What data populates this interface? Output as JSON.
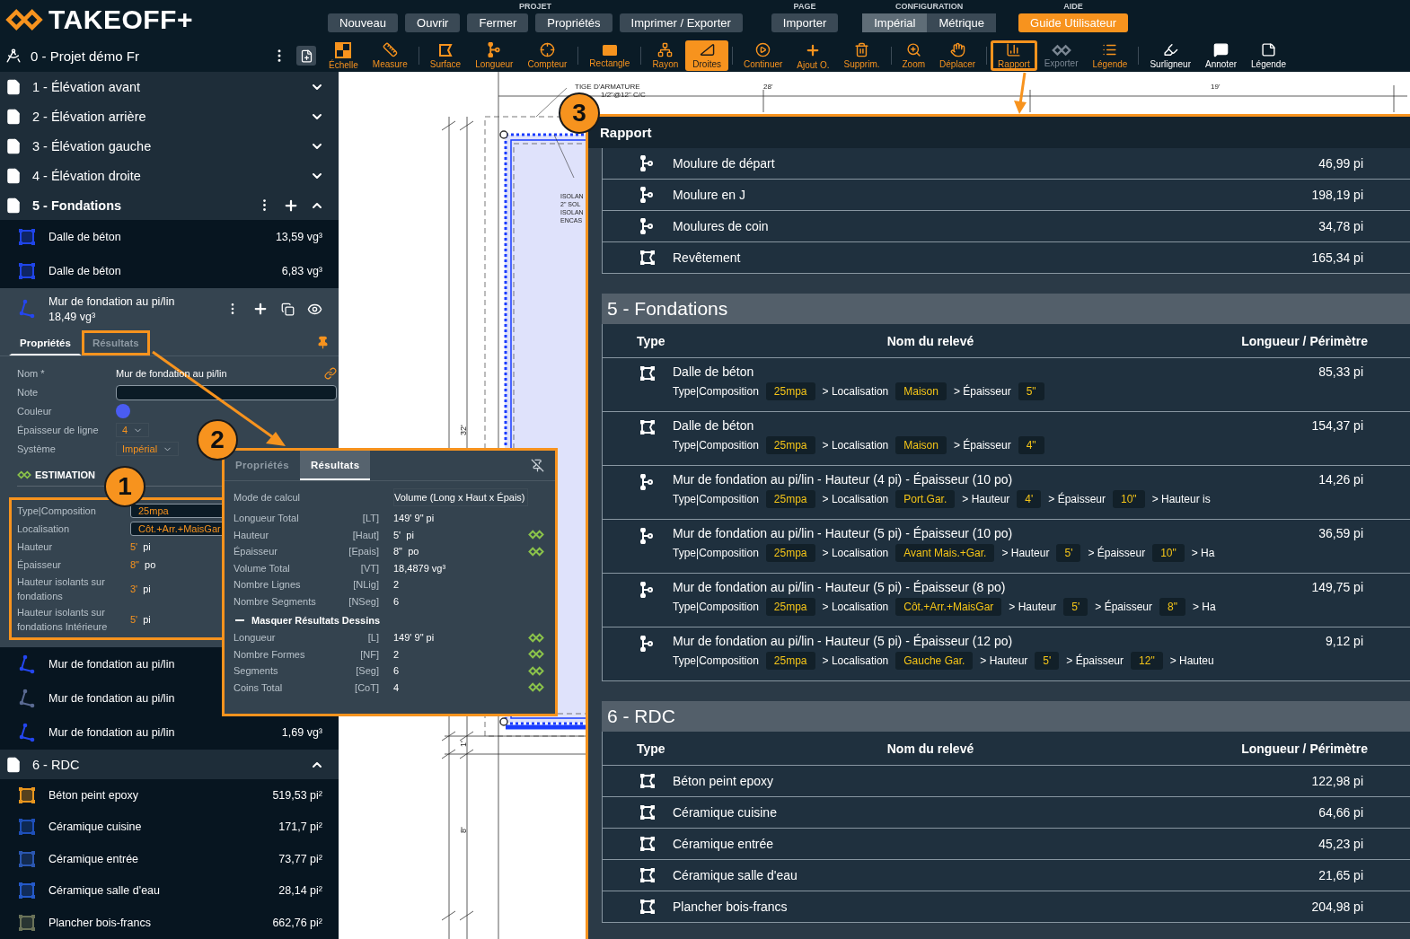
{
  "header": {
    "logo": "TAKEOFF+",
    "menu_groups": [
      {
        "title": "PROJET",
        "kind": "buttons",
        "buttons": [
          {
            "label": "Nouveau"
          },
          {
            "label": "Ouvrir"
          },
          {
            "label": "Fermer"
          },
          {
            "label": "Propriétés"
          },
          {
            "label": "Imprimer / Exporter"
          }
        ]
      },
      {
        "title": "PAGE",
        "kind": "buttons",
        "buttons": [
          {
            "label": "Importer"
          }
        ]
      },
      {
        "title": "CONFIGURATION",
        "kind": "segmented",
        "buttons": [
          {
            "label": "Impérial",
            "selected": true
          },
          {
            "label": "Métrique",
            "selected": false
          }
        ]
      },
      {
        "title": "AIDE",
        "kind": "primary",
        "buttons": [
          {
            "label": "Guide Utilisateur"
          }
        ]
      }
    ],
    "project": {
      "title": "0 - Projet démo Fr"
    },
    "toolbar": [
      {
        "tools": [
          {
            "label": "Échelle",
            "kind": "tool",
            "selected": false,
            "disabled": false,
            "highlighted": false
          },
          {
            "label": "Measure",
            "kind": "tool",
            "selected": false,
            "disabled": false,
            "highlighted": false
          }
        ]
      },
      {
        "tools": [
          {
            "label": "Surface",
            "kind": "tool",
            "selected": false,
            "disabled": false,
            "highlighted": false
          },
          {
            "label": "Longueur",
            "kind": "tool",
            "selected": false,
            "disabled": false,
            "highlighted": false
          },
          {
            "label": "Compteur",
            "kind": "tool",
            "selected": false,
            "disabled": false,
            "highlighted": false
          }
        ]
      },
      {
        "tools": [
          {
            "label": "Rectangle",
            "kind": "tool",
            "selected": false,
            "disabled": false,
            "highlighted": false
          }
        ]
      },
      {
        "tools": [
          {
            "label": "Rayon",
            "kind": "tool",
            "selected": false,
            "disabled": false,
            "highlighted": false
          },
          {
            "label": "Droites",
            "kind": "tool",
            "selected": true,
            "disabled": false,
            "highlighted": false
          }
        ]
      },
      {
        "tools": [
          {
            "label": "Continuer",
            "kind": "tool",
            "selected": false,
            "disabled": false,
            "highlighted": false
          },
          {
            "label": "Ajout O.",
            "kind": "tool",
            "selected": false,
            "disabled": false,
            "highlighted": false
          },
          {
            "label": "Supprim.",
            "kind": "tool",
            "selected": false,
            "disabled": false,
            "highlighted": false
          }
        ]
      },
      {
        "tools": [
          {
            "label": "Zoom",
            "kind": "tool",
            "selected": false,
            "disabled": false,
            "highlighted": false
          },
          {
            "label": "Déplacer",
            "kind": "tool",
            "selected": false,
            "disabled": false,
            "highlighted": false
          }
        ]
      },
      {
        "tools": [
          {
            "label": "Rapport",
            "kind": "tool",
            "selected": false,
            "disabled": false,
            "highlighted": true
          },
          {
            "label": "Exporter",
            "kind": "tool",
            "selected": false,
            "disabled": true,
            "highlighted": false
          },
          {
            "label": "Légende",
            "kind": "tool",
            "selected": false,
            "disabled": false,
            "highlighted": false
          }
        ]
      },
      {
        "tools": [
          {
            "label": "Surligneur",
            "kind": "annotate",
            "selected": false,
            "disabled": false,
            "highlighted": false
          },
          {
            "label": "Annoter",
            "kind": "annotate",
            "selected": false,
            "disabled": false,
            "highlighted": false
          },
          {
            "label": "Légende",
            "kind": "annotate",
            "selected": false,
            "disabled": false,
            "highlighted": false
          }
        ]
      }
    ]
  },
  "sidebar": {
    "pages": [
      {
        "title": "1 - Élévation avant",
        "active": false,
        "expanded": false
      },
      {
        "title": "2 - Élévation arrière",
        "active": false,
        "expanded": false
      },
      {
        "title": "3 - Élévation gauche",
        "active": false,
        "expanded": false
      },
      {
        "title": "4 - Élévation droite",
        "active": false,
        "expanded": false
      },
      {
        "title": "5 - Fondations",
        "active": true,
        "expanded": true,
        "items": [
          {
            "name": "Dalle de béton",
            "value": "13,59 vg³",
            "kind": "area",
            "color": "#1f44e8",
            "selected": false
          },
          {
            "name": "Dalle de béton",
            "value": "6,83 vg³",
            "kind": "area",
            "color": "#1f44e8",
            "selected": false
          },
          {
            "name": "Mur de fondation au pi/lin",
            "value": "18,49 vg³",
            "kind": "line",
            "color": "#2446f0",
            "selected": true
          },
          {
            "name": "Mur de fondation au pi/lin",
            "kind": "line",
            "color": "#2446f0",
            "selected": false
          },
          {
            "name": "Mur de fondation au pi/lin",
            "kind": "line",
            "color": "#5a6a92",
            "selected": false
          },
          {
            "name": "Mur de fondation au pi/lin",
            "value": "1,69 vg³",
            "kind": "line",
            "color": "#2446f0",
            "selected": false
          }
        ]
      },
      {
        "title": "6 - RDC",
        "active": false,
        "expanded": true,
        "items": [
          {
            "name": "Béton peint epoxy",
            "value": "519,53 pi²",
            "kind": "area",
            "color": "#e8961e",
            "selected": false
          },
          {
            "name": "Céramique cuisine",
            "value": "171,7 pi²",
            "kind": "area",
            "color": "#1e4fb8",
            "selected": false
          },
          {
            "name": "Céramique entrée",
            "value": "73,77 pi²",
            "kind": "area",
            "color": "#2a56b0",
            "selected": false
          },
          {
            "name": "Céramique salle d'eau",
            "value": "28,14 pi²",
            "kind": "area",
            "color": "#2459c8",
            "selected": false
          },
          {
            "name": "Plancher bois-francs",
            "value": "662,76 pi²",
            "kind": "area",
            "color": "#6a7258",
            "selected": false
          }
        ]
      }
    ],
    "details": {
      "tabs": [
        {
          "label": "Propriétés",
          "selected": true,
          "highlighted": false
        },
        {
          "label": "Résultats",
          "selected": false,
          "highlighted": true
        }
      ],
      "fields": [
        {
          "label": "Nom *",
          "kind": "text",
          "value": "Mur de fondation au pi/lin"
        },
        {
          "label": "Note",
          "kind": "input"
        },
        {
          "label": "Couleur",
          "kind": "color",
          "color": "#4a5cf2"
        },
        {
          "label": "Épaisseur de ligne",
          "kind": "select",
          "value": "4"
        },
        {
          "label": "Système",
          "kind": "select",
          "value": "Impérial"
        }
      ],
      "estimation": {
        "title": "ESTIMATION",
        "rows": [
          {
            "label": "Type|Composition",
            "kind": "field",
            "value": "25mpa"
          },
          {
            "label": "Localisation",
            "kind": "field",
            "value": "Côt.+Arr.+MaisGar"
          },
          {
            "label": "Hauteur",
            "kind": "measure",
            "value": "5'",
            "unit": "pi"
          },
          {
            "label": "Épaisseur",
            "kind": "measure",
            "value": "8\"",
            "unit": "po"
          },
          {
            "label": "Hauteur isolants sur fondations",
            "kind": "measure",
            "value": "3'",
            "unit": "pi"
          },
          {
            "label": "Hauteur isolants sur fondations Intérieure",
            "kind": "measure",
            "value": "5'",
            "unit": "pi"
          }
        ]
      }
    }
  },
  "canvas": {
    "labels": [
      {
        "text": "TIGE D'ARMATURE"
      },
      {
        "text": "1/2\"@12\" C/C"
      },
      {
        "text": "28'"
      },
      {
        "text": "19'"
      },
      {
        "text": "ISOLAN"
      },
      {
        "text": "2\" SOL"
      },
      {
        "text": "ISOLAN"
      },
      {
        "text": "ENCAS"
      },
      {
        "text": "32'"
      },
      {
        "text": "1'"
      },
      {
        "text": "8'"
      }
    ]
  },
  "results_popup": {
    "tabs": [
      {
        "label": "Propriétés",
        "selected": false
      },
      {
        "label": "Résultats",
        "selected": true
      }
    ],
    "mode": {
      "label": "Mode de calcul",
      "value": "Volume (Long x Haut x Épais)"
    },
    "rows": [
      {
        "label": "Longueur Total",
        "code": "[LT]",
        "value": "149' 9\" pi",
        "linked": false
      },
      {
        "label": "Hauteur",
        "code": "[Haut]",
        "value": "5'  pi",
        "linked": true
      },
      {
        "label": "Épaisseur",
        "code": "[Epais]",
        "value": "8\"  po",
        "linked": true
      },
      {
        "label": "Volume Total",
        "code": "[VT]",
        "value": "18,4879 vg³",
        "linked": false
      },
      {
        "label": "Nombre Lignes",
        "code": "[NLig]",
        "value": "2",
        "linked": false
      },
      {
        "label": "Nombre Segments",
        "code": "[NSeg]",
        "value": "6",
        "linked": false
      }
    ],
    "section": {
      "title": "Masquer Résultats Dessins",
      "expanded": true
    },
    "section_rows": [
      {
        "label": "Longueur",
        "code": "[L]",
        "value": "149' 9\" pi",
        "linked": true
      },
      {
        "label": "Nombre Formes",
        "code": "[NF]",
        "value": "2",
        "linked": true
      },
      {
        "label": "Segments",
        "code": "[Seg]",
        "value": "6",
        "linked": true
      },
      {
        "label": "Coins Total",
        "code": "[CoT]",
        "value": "4",
        "linked": true
      }
    ]
  },
  "report": {
    "title": "Rapport",
    "summary": [
      {
        "name": "Moulure de départ",
        "value": "46,99 pi",
        "kind": "line"
      },
      {
        "name": "Moulure en J",
        "value": "198,19 pi",
        "kind": "line"
      },
      {
        "name": "Moulures de coin",
        "value": "34,78 pi",
        "kind": "line"
      },
      {
        "name": "Revêtement",
        "value": "165,34 pi",
        "kind": "area"
      }
    ],
    "sections": [
      {
        "title": "5 - Fondations",
        "columns": [
          "Type",
          "Nom du relevé",
          "Longueur / Périmètre"
        ],
        "rows": [
          {
            "kind": "area",
            "name": "Dalle de béton",
            "value": "85,33 pi",
            "attributes": [
              {
                "label": "Type|Composition",
                "value": "25mpa"
              },
              {
                "label": "> Localisation",
                "value": "Maison"
              },
              {
                "label": "> Épaisseur",
                "value": "5\""
              }
            ]
          },
          {
            "kind": "area",
            "name": "Dalle de béton",
            "value": "154,37 pi",
            "attributes": [
              {
                "label": "Type|Composition",
                "value": "25mpa"
              },
              {
                "label": "> Localisation",
                "value": "Maison"
              },
              {
                "label": "> Épaisseur",
                "value": "4\""
              }
            ]
          },
          {
            "kind": "line",
            "name": "Mur de fondation au pi/lin - Hauteur (4 pi) - Épaisseur (10 po)",
            "value": "14,26 pi",
            "attributes": [
              {
                "label": "Type|Composition",
                "value": "25mpa"
              },
              {
                "label": "> Localisation",
                "value": "Port.Gar."
              },
              {
                "label": "> Hauteur",
                "value": "4'"
              },
              {
                "label": "> Épaisseur",
                "value": "10\""
              },
              {
                "label": "> Hauteur is"
              }
            ]
          },
          {
            "kind": "line",
            "name": "Mur de fondation au pi/lin - Hauteur (5 pi) - Épaisseur (10 po)",
            "value": "36,59 pi",
            "attributes": [
              {
                "label": "Type|Composition",
                "value": "25mpa"
              },
              {
                "label": "> Localisation",
                "value": "Avant Mais.+Gar."
              },
              {
                "label": "> Hauteur",
                "value": "5'"
              },
              {
                "label": "> Épaisseur",
                "value": "10\""
              },
              {
                "label": "> Ha"
              }
            ]
          },
          {
            "kind": "line",
            "name": "Mur de fondation au pi/lin - Hauteur (5 pi) - Épaisseur (8 po)",
            "value": "149,75 pi",
            "attributes": [
              {
                "label": "Type|Composition",
                "value": "25mpa"
              },
              {
                "label": "> Localisation",
                "value": "Côt.+Arr.+MaisGar"
              },
              {
                "label": "> Hauteur",
                "value": "5'"
              },
              {
                "label": "> Épaisseur",
                "value": "8\""
              },
              {
                "label": "> Ha"
              }
            ]
          },
          {
            "kind": "line",
            "name": "Mur de fondation au pi/lin - Hauteur (5 pi) - Épaisseur (12 po)",
            "value": "9,12 pi",
            "attributes": [
              {
                "label": "Type|Composition",
                "value": "25mpa"
              },
              {
                "label": "> Localisation",
                "value": "Gauche Gar."
              },
              {
                "label": "> Hauteur",
                "value": "5'"
              },
              {
                "label": "> Épaisseur",
                "value": "12\""
              },
              {
                "label": "> Hauteu"
              }
            ]
          }
        ]
      },
      {
        "title": "6 - RDC",
        "columns": [
          "Type",
          "Nom du relevé",
          "Longueur / Périmètre"
        ],
        "rows": [
          {
            "kind": "area",
            "name": "Béton peint epoxy",
            "value": "122,98 pi"
          },
          {
            "kind": "area",
            "name": "Céramique cuisine",
            "value": "64,66 pi"
          },
          {
            "kind": "area",
            "name": "Céramique entrée",
            "value": "45,23 pi"
          },
          {
            "kind": "area",
            "name": "Céramique salle d'eau",
            "value": "21,65 pi"
          },
          {
            "kind": "area",
            "name": "Plancher bois-francs",
            "value": "204,98 pi"
          }
        ]
      }
    ]
  },
  "callouts": [
    {
      "number": "1"
    },
    {
      "number": "2"
    },
    {
      "number": "3"
    }
  ]
}
